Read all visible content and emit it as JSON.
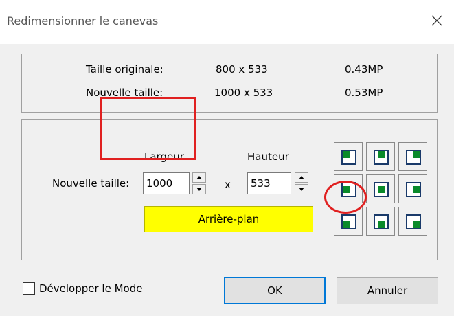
{
  "window": {
    "title": "Redimensionner le canevas"
  },
  "info": {
    "rows": [
      {
        "label": "Taille originale:",
        "size": "800 x 533",
        "mp": "0.43MP"
      },
      {
        "label": "Nouvelle taille:",
        "size": "1000 x 533",
        "mp": "0.53MP"
      }
    ]
  },
  "resize": {
    "new_size_label": "Nouvelle taille:",
    "width_label": "Largeur",
    "height_label": "Hauteur",
    "width_value": "1000",
    "height_value": "533",
    "separator": "x",
    "background_label": "Arrière-plan",
    "background_color": "#ffff00",
    "anchor_selected": "middle-left"
  },
  "footer": {
    "expand_mode_label": "Développer le Mode",
    "expand_mode_checked": false,
    "ok_label": "OK",
    "cancel_label": "Annuler"
  },
  "colors": {
    "highlight": "#e02020",
    "anchor_dot": "#0a8a2a",
    "focus": "#0078d7"
  }
}
